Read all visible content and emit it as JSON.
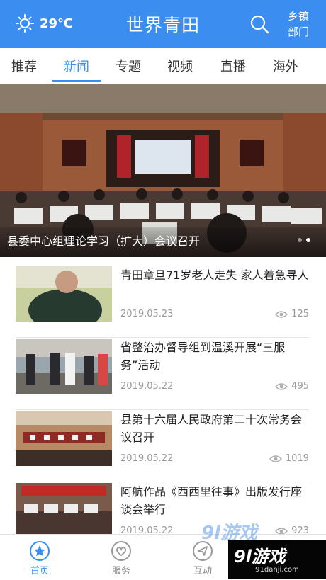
{
  "header": {
    "temperature": "29℃",
    "title": "世界青田",
    "town_line1": "乡镇",
    "town_line2": "部门",
    "bg_color": "#3b8ef0"
  },
  "tabs": [
    {
      "label": "推荐",
      "active": false
    },
    {
      "label": "新闻",
      "active": true
    },
    {
      "label": "专题",
      "active": false
    },
    {
      "label": "视频",
      "active": false
    },
    {
      "label": "直播",
      "active": false
    },
    {
      "label": "海外",
      "active": false
    }
  ],
  "banner": {
    "caption": "县委中心组理论学习（扩大）会议召开",
    "slide_count": 2,
    "active_slide": 1
  },
  "news": [
    {
      "title": "青田章旦71岁老人走失 家人着急寻人",
      "date": "2019.05.23",
      "views": "125"
    },
    {
      "title": "省整治办督导组到温溪开展“三服务”活动",
      "date": "2019.05.22",
      "views": "495"
    },
    {
      "title": "县第十六届人民政府第二十次常务会议召开",
      "date": "2019.05.22",
      "views": "1019"
    },
    {
      "title": "阿航作品《西西里往事》出版发行座谈会举行",
      "date": "2019.05.22",
      "views": "923"
    }
  ],
  "bottom_nav": [
    {
      "label": "首页",
      "icon": "star-icon",
      "active": true
    },
    {
      "label": "服务",
      "icon": "heart-icon",
      "active": false
    },
    {
      "label": "互动",
      "icon": "send-icon",
      "active": false
    }
  ],
  "watermark": {
    "center_text": "9l游戏",
    "logo_text": "9l游戏",
    "url": "91danji.com"
  }
}
